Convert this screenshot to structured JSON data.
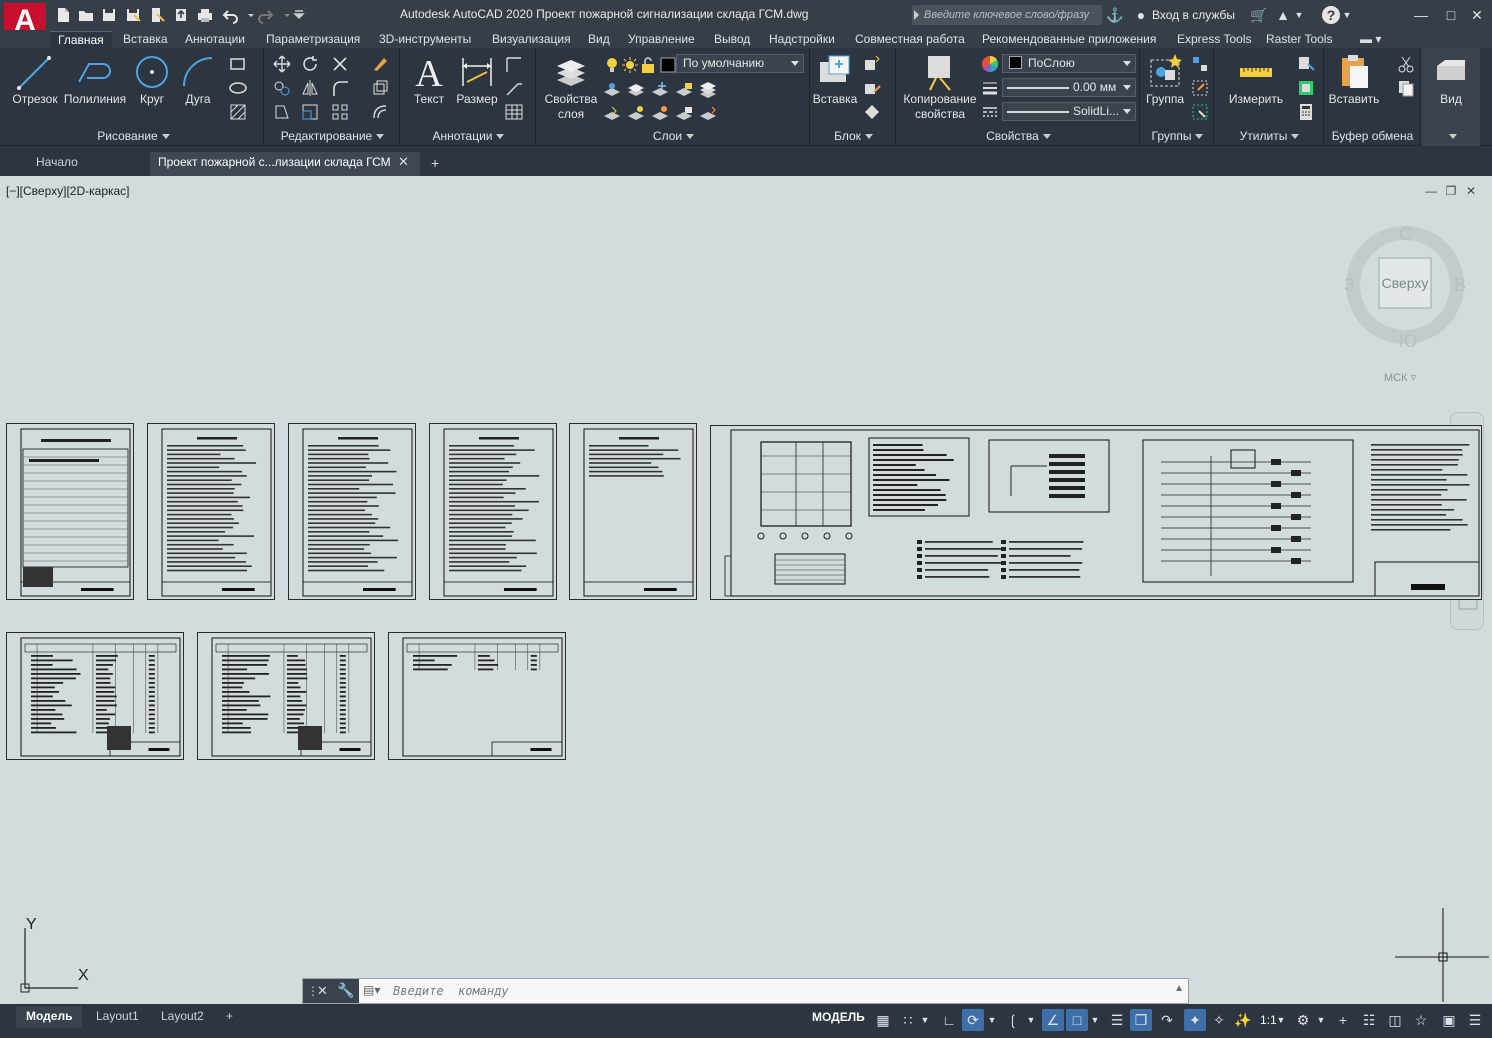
{
  "app": {
    "logo": "A",
    "title": "Autodesk AutoCAD 2020   Проект пожарной сигнализации склада ГСМ.dwg",
    "search_placeholder": "Введите ключевое слово/фразу",
    "signin": "Вход в службы"
  },
  "ribbon_tabs": [
    "Главная",
    "Вставка",
    "Аннотации",
    "Параметризация",
    "3D-инструменты",
    "Визуализация",
    "Вид",
    "Управление",
    "Вывод",
    "Надстройки",
    "Совместная работа",
    "Рекомендованные приложения",
    "Express Tools",
    "Raster Tools"
  ],
  "ribbon": {
    "draw": {
      "title": "Рисование",
      "line": "Отрезок",
      "polyline": "Полилиния",
      "circle": "Круг",
      "arc": "Дуга"
    },
    "modify": {
      "title": "Редактирование"
    },
    "annotation": {
      "title": "Аннотации",
      "text": "Текст",
      "dimension": "Размер"
    },
    "layers": {
      "title": "Слои",
      "layer_props_1": "Свойства",
      "layer_props_2": "слоя",
      "current_layer": "По умолчанию"
    },
    "block": {
      "title": "Блок",
      "insert": "Вставка"
    },
    "properties": {
      "title": "Свойства",
      "match_1": "Копирование",
      "match_2": "свойства",
      "color": "ПоСлою",
      "lineweight": "0.00 мм",
      "linetype": "SolidLi..."
    },
    "groups": {
      "title": "Группы",
      "group": "Группа"
    },
    "utilities": {
      "title": "Утилиты",
      "measure": "Измерить"
    },
    "clipboard": {
      "title": "Буфер обмена",
      "paste": "Вставить"
    },
    "view": {
      "title": "Вид"
    }
  },
  "file_tabs": {
    "start": "Начало",
    "current": "Проект пожарной с...лизации склада ГСМ"
  },
  "viewport": {
    "label": "[−][Сверху][2D-каркас]",
    "viewcube": {
      "face": "Сверху",
      "north": "С",
      "south": "Ю",
      "west": "З",
      "east": "В"
    },
    "ucs_menu": "МСК",
    "ucs_x": "X",
    "ucs_y": "Y"
  },
  "command": {
    "placeholder": "Введите  команду"
  },
  "layout_tabs": [
    "Модель",
    "Layout1",
    "Layout2"
  ],
  "status": {
    "model": "МОДЕЛЬ",
    "scale": "1:1"
  },
  "colors": {
    "title_bg": "#383e47",
    "ribbon_bg": "#2d3540",
    "canvas_bg": "#d2dcdf",
    "logo_red": "#c8102e"
  }
}
